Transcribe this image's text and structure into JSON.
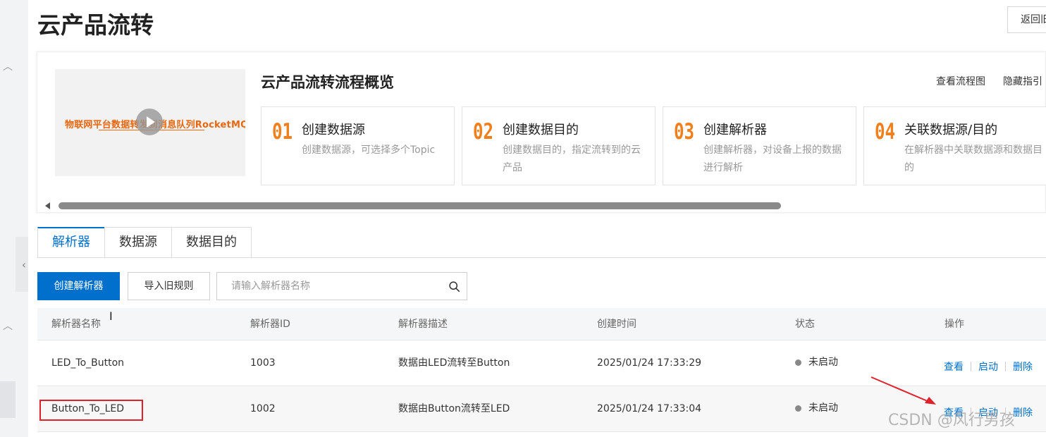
{
  "page": {
    "title": "云产品流转",
    "back_label": "返回旧版"
  },
  "overview": {
    "video_caption": "物联网平台数据转发到消息队列RocketMQ",
    "title": "云产品流转流程概览",
    "view_flowchart": "查看流程图",
    "hide_guide": "隐藏指引",
    "steps": [
      {
        "num": "01",
        "title": "创建数据源",
        "desc": "创建数据源，可选择多个Topic"
      },
      {
        "num": "02",
        "title": "创建数据目的",
        "desc": "创建数据目的，指定流转到的云产品"
      },
      {
        "num": "03",
        "title": "创建解析器",
        "desc": "创建解析器，对设备上报的数据进行解析"
      },
      {
        "num": "04",
        "title": "关联数据源/目的",
        "desc": "在解析器中关联数据源和数据目的"
      }
    ]
  },
  "tabs": [
    {
      "label": "解析器",
      "active": true
    },
    {
      "label": "数据源",
      "active": false
    },
    {
      "label": "数据目的",
      "active": false
    }
  ],
  "toolbar": {
    "create_label": "创建解析器",
    "import_label": "导入旧规则",
    "search_placeholder": "请输入解析器名称"
  },
  "table": {
    "headers": [
      "解析器名称",
      "解析器ID",
      "解析器描述",
      "创建时间",
      "状态",
      "操作"
    ],
    "rows": [
      {
        "name": "LED_To_Button",
        "id": "1003",
        "desc": "数据由LED流转至Button",
        "time": "2025/01/24 17:33:29",
        "status": "未启动",
        "actions": [
          "查看",
          "启动",
          "删除"
        ]
      },
      {
        "name": "Button_To_LED",
        "id": "1002",
        "desc": "数据由Button流转至LED",
        "time": "2025/01/24 17:33:04",
        "status": "未启动",
        "actions": [
          "查看",
          "启动",
          "删除"
        ]
      }
    ]
  },
  "colors": {
    "primary": "#0070cc",
    "step_number": "#f07f1c",
    "annotation_red": "#e0202a"
  },
  "watermark": "CSDN @风行男孩"
}
